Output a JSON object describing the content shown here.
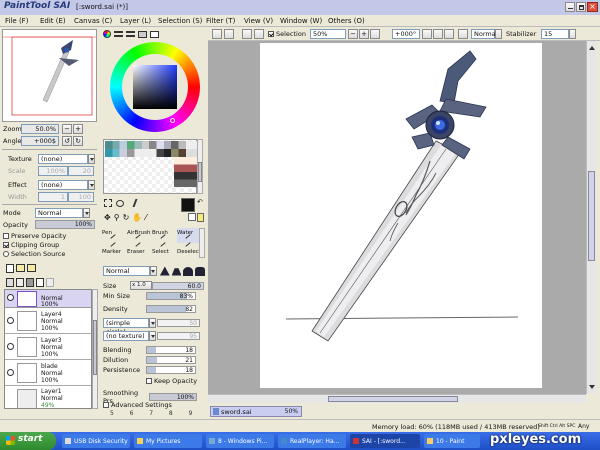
{
  "titlebar": {
    "app_logo": "PaintTool SAI",
    "title": "[:sword.sai (*)]",
    "bg_color": "#c3c7e8"
  },
  "menu": [
    {
      "label": "File (F)"
    },
    {
      "label": "Edit (E)"
    },
    {
      "label": "Canvas (C)"
    },
    {
      "label": "Layer (L)"
    },
    {
      "label": "Selection (S)"
    },
    {
      "label": "Filter (T)"
    },
    {
      "label": "View (V)"
    },
    {
      "label": "Window (W)"
    },
    {
      "label": "Others (O)"
    }
  ],
  "toolbar": {
    "selection_label": "Selection",
    "zoom": "50%",
    "rotation": "+000°",
    "mode": "Normal",
    "stabilizer_label": "Stabilizer",
    "stabilizer_value": "15"
  },
  "navigator": {
    "zoom_label": "Zoom",
    "zoom_value": "50.0%",
    "angle_label": "Angle",
    "angle_value": "+000$"
  },
  "texture": {
    "texture_label": "Texture",
    "texture_value": "(none)",
    "scale_label": "Scale",
    "scale_value": "100%",
    "strength_value": "20",
    "effect_label": "Effect",
    "effect_value": "(none)",
    "width_label": "Width",
    "width_value": "1",
    "width_max": "100"
  },
  "layer_props": {
    "mode_label": "Mode",
    "mode_value": "Normal",
    "opacity_label": "Opacity",
    "opacity_value": "100%",
    "preserve_label": "Preserve Opacity",
    "clipping_label": "Clipping Group",
    "selection_source_label": "Selection Source"
  },
  "layers": [
    {
      "name": "",
      "mode": "Normal",
      "opacity": "100%",
      "selected": true
    },
    {
      "name": "Layer4",
      "mode": "Normal",
      "opacity": "100%"
    },
    {
      "name": "Layer3",
      "mode": "Normal",
      "opacity": "100%"
    },
    {
      "name": "blade",
      "mode": "Normal",
      "opacity": "100%"
    },
    {
      "name": "Layer1",
      "mode": "Normal",
      "opacity": "49%"
    }
  ],
  "tools_grid": [
    {
      "label": "Pen"
    },
    {
      "label": "AirBrush"
    },
    {
      "label": "Brush"
    },
    {
      "label": "Water"
    },
    {
      "label": "Marker"
    },
    {
      "label": "Eraser"
    },
    {
      "label": "Select"
    },
    {
      "label": "Deselect"
    }
  ],
  "brush": {
    "mode": "Normal",
    "size_label": "Size",
    "size_mult": "x 1.0",
    "size_value": "60.0",
    "minsize_label": "Min Size",
    "minsize_value": "83%",
    "minsize_level": 83,
    "density_label": "Density",
    "density_value": "82",
    "density_level": 82,
    "shape_value": "(simple circle)",
    "shape_num": "50",
    "texture_value": "(no texture)",
    "texture_num": "95",
    "blending_label": "Blending",
    "blending_value": "18",
    "blending_level": 18,
    "dilution_label": "Dilution",
    "dilution_value": "21",
    "dilution_level": 21,
    "persistence_label": "Persistence",
    "persistence_value": "18",
    "persistence_level": 18,
    "keep_opacity_label": "Keep Opacity",
    "smoothing_label": "Smoothing Prs",
    "smoothing_value": "100%",
    "advanced_label": "Advanced Settings",
    "numbers": "5  6  7  8  9"
  },
  "doc_tab": {
    "name": "sword.sai",
    "zoom": "50%"
  },
  "status": {
    "memory": "Memory load: 60% (118MB used / 413MB reserved)",
    "keys": "Shift Ctrl Alt SPC",
    "any": "Any"
  },
  "taskbar": {
    "start": "start",
    "items": [
      {
        "label": "USB Disk Security"
      },
      {
        "label": "My Pictures"
      },
      {
        "label": "8 - Windows Pi..."
      },
      {
        "label": "RealPlayer: Ha..."
      },
      {
        "label": "SAI - [:sword..."
      },
      {
        "label": "10 - Paint"
      }
    ],
    "watermark": "pxleyes.com"
  }
}
